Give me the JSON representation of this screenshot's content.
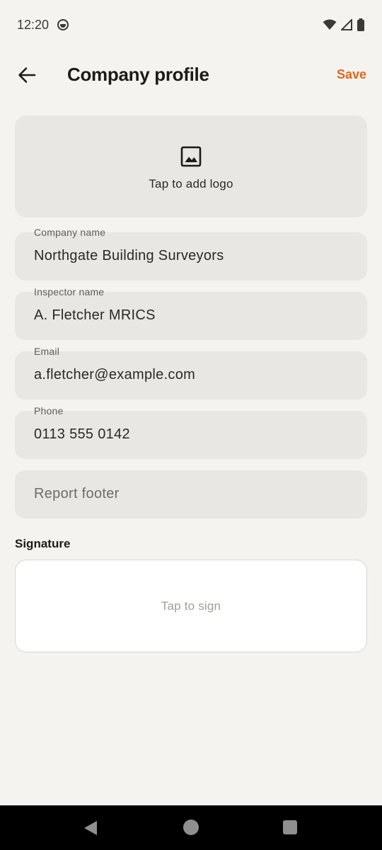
{
  "status_bar": {
    "time": "12:20",
    "icons": [
      "notification-icon",
      "wifi-icon",
      "signal-icon",
      "battery-icon"
    ]
  },
  "app_bar": {
    "title": "Company profile",
    "save_label": "Save",
    "accent_color": "#e2661c"
  },
  "logo": {
    "label": "Tap to add logo",
    "icon": "image-icon"
  },
  "fields": {
    "company_name": {
      "label": "Company name",
      "value": "Northgate Building Surveyors"
    },
    "inspector_name": {
      "label": "Inspector name",
      "value": "A. Fletcher MRICS"
    },
    "email": {
      "label": "Email",
      "value": "a.fletcher@example.com"
    },
    "phone": {
      "label": "Phone",
      "value": "0113 555 0142"
    },
    "report_footer": {
      "placeholder": "Report footer",
      "value": ""
    }
  },
  "signature": {
    "heading": "Signature",
    "placeholder": "Tap to sign"
  },
  "nav_bar": {
    "icons": [
      "back-triangle-icon",
      "home-circle-icon",
      "recents-square-icon"
    ]
  }
}
